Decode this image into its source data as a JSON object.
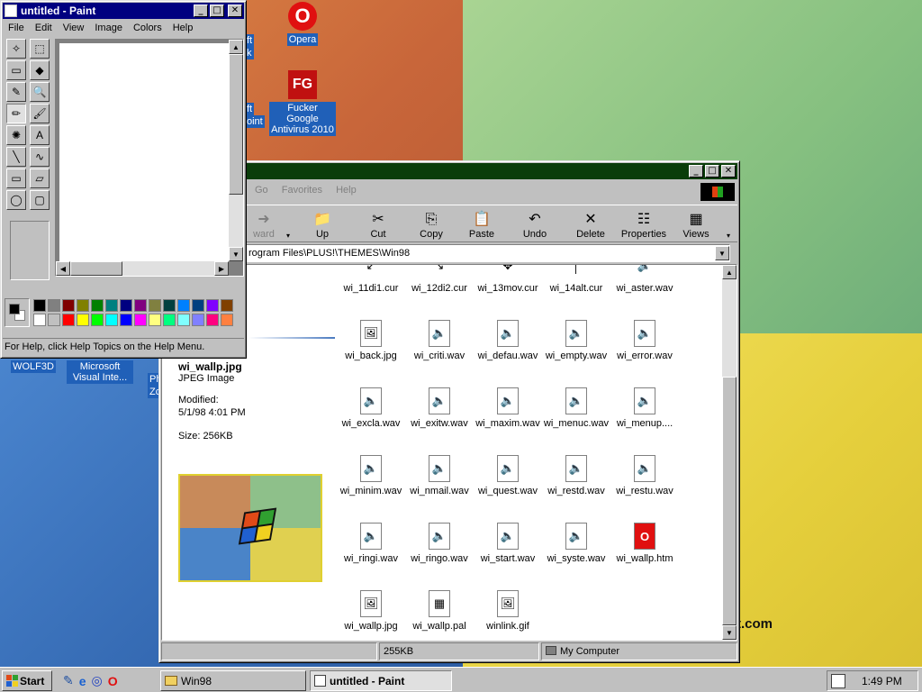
{
  "desktop": {
    "icons": [
      {
        "label": "Opera",
        "glyph": "O",
        "icon": "opera-icon"
      },
      {
        "label": "Fucker Google Antivirus 2010",
        "glyph": "FG",
        "icon": "antivirus-icon"
      },
      {
        "label": "WOLF3D",
        "icon": "wolf3d-icon"
      },
      {
        "label": "Microsoft Visual Inte...",
        "icon": "visual-interdev-icon"
      },
      {
        "label": "ft",
        "icon": "shortcut-icon"
      },
      {
        "label": "k",
        "icon": "shortcut-icon"
      },
      {
        "label": "ft",
        "icon": "shortcut-icon"
      },
      {
        "label": "oint",
        "icon": "shortcut-icon"
      },
      {
        "label": "Ph",
        "icon": "shortcut-icon"
      },
      {
        "label": "Zc",
        "icon": "shortcut-icon"
      }
    ],
    "wallpaper_text": "t.com"
  },
  "paint": {
    "title": "untitled - Paint",
    "menu": [
      "File",
      "Edit",
      "View",
      "Image",
      "Colors",
      "Help"
    ],
    "tools": [
      "free-select",
      "rect-select",
      "eraser",
      "fill",
      "picker",
      "magnifier",
      "pencil",
      "brush",
      "airbrush",
      "text",
      "line",
      "curve",
      "rectangle",
      "polygon",
      "ellipse",
      "rounded-rect"
    ],
    "tool_glyphs": [
      "✧",
      "⬚",
      "▭",
      "◆",
      "✎",
      "🔍",
      "✏",
      "🖌",
      "✺",
      "A",
      "╲",
      "∿",
      "▭",
      "▱",
      "◯",
      "▢"
    ],
    "palette_top": [
      "#000000",
      "#808080",
      "#800000",
      "#808000",
      "#008000",
      "#008080",
      "#000080",
      "#800080",
      "#808040",
      "#004040",
      "#0080ff",
      "#004080",
      "#8000ff",
      "#804000"
    ],
    "palette_bottom": [
      "#ffffff",
      "#c0c0c0",
      "#ff0000",
      "#ffff00",
      "#00ff00",
      "#00ffff",
      "#0000ff",
      "#ff00ff",
      "#ffff80",
      "#00ff80",
      "#80ffff",
      "#8080ff",
      "#ff0080",
      "#ff8040"
    ],
    "status": "For Help, click Help Topics on the Help Menu."
  },
  "explorer": {
    "menu": [
      "Go",
      "Favorites",
      "Help"
    ],
    "toolbar": [
      {
        "label": "ward",
        "glyph": "➜",
        "icon": "forward-icon"
      },
      {
        "label": "Up",
        "glyph": "📁",
        "icon": "up-folder-icon"
      },
      {
        "label": "Cut",
        "glyph": "✂",
        "icon": "cut-icon"
      },
      {
        "label": "Copy",
        "glyph": "⎘",
        "icon": "copy-icon"
      },
      {
        "label": "Paste",
        "glyph": "📋",
        "icon": "paste-icon"
      },
      {
        "label": "Undo",
        "glyph": "↶",
        "icon": "undo-icon"
      },
      {
        "label": "Delete",
        "glyph": "✕",
        "icon": "delete-icon"
      },
      {
        "label": "Properties",
        "glyph": "☷",
        "icon": "properties-icon"
      },
      {
        "label": "Views",
        "glyph": "▦",
        "icon": "views-icon"
      }
    ],
    "address": "rogram Files\\PLUS!\\THEMES\\Win98",
    "info": {
      "filename": "wi_wallp.jpg",
      "type": "JPEG Image",
      "modified_label": "Modified:",
      "modified": "5/1/98 4:01 PM",
      "size": "Size: 256KB"
    },
    "files": [
      {
        "name": "wi_11di1.cur",
        "glyph": "↙"
      },
      {
        "name": "wi_12di2.cur",
        "glyph": "↘"
      },
      {
        "name": "wi_13mov.cur",
        "glyph": "✥"
      },
      {
        "name": "wi_14alt.cur",
        "glyph": "│"
      },
      {
        "name": "wi_aster.wav",
        "glyph": "🔈"
      },
      {
        "name": "wi_back.jpg",
        "glyph": "🖼"
      },
      {
        "name": "wi_criti.wav",
        "glyph": "🔈"
      },
      {
        "name": "wi_defau.wav",
        "glyph": "🔈"
      },
      {
        "name": "wi_empty.wav",
        "glyph": "🔈"
      },
      {
        "name": "wi_error.wav",
        "glyph": "🔈"
      },
      {
        "name": "wi_excla.wav",
        "glyph": "🔈"
      },
      {
        "name": "wi_exitw.wav",
        "glyph": "🔈"
      },
      {
        "name": "wi_maxim.wav",
        "glyph": "🔈"
      },
      {
        "name": "wi_menuc.wav",
        "glyph": "🔈"
      },
      {
        "name": "wi_menup....",
        "glyph": "🔈"
      },
      {
        "name": "wi_minim.wav",
        "glyph": "🔈"
      },
      {
        "name": "wi_nmail.wav",
        "glyph": "🔈"
      },
      {
        "name": "wi_quest.wav",
        "glyph": "🔈"
      },
      {
        "name": "wi_restd.wav",
        "glyph": "🔈"
      },
      {
        "name": "wi_restu.wav",
        "glyph": "🔈"
      },
      {
        "name": "wi_ringi.wav",
        "glyph": "🔈"
      },
      {
        "name": "wi_ringo.wav",
        "glyph": "🔈"
      },
      {
        "name": "wi_start.wav",
        "glyph": "🔈"
      },
      {
        "name": "wi_syste.wav",
        "glyph": "🔈"
      },
      {
        "name": "wi_wallp.htm",
        "glyph": "O"
      },
      {
        "name": "wi_wallp.jpg",
        "glyph": "🖼"
      },
      {
        "name": "wi_wallp.pal",
        "glyph": "▦"
      },
      {
        "name": "winlink.gif",
        "glyph": "🖼"
      }
    ],
    "status_size": "255KB",
    "status_zone": "My Computer"
  },
  "taskbar": {
    "start": "Start",
    "tasks": [
      "Win98",
      "untitled - Paint"
    ],
    "clock": "1:49 PM"
  },
  "colors": {
    "titlebar_active": "#000080",
    "explorer_titlebar": "#0a3d0a"
  }
}
